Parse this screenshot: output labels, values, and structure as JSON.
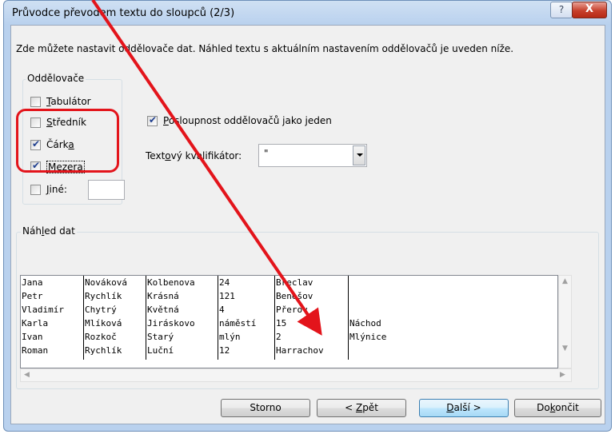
{
  "window": {
    "title": "Průvodce převodem textu do sloupců (2/3)",
    "help_glyph": "?",
    "close_glyph": "X"
  },
  "description": "Zde můžete nastavit oddělovače dat. Náhled textu s aktuálním nastavením oddělovačů je uveden níže.",
  "delimiters": {
    "group_label": "Oddělovače",
    "items": [
      {
        "label_u": "T",
        "label_rest": "abulátor",
        "checked": false
      },
      {
        "label_u": "S",
        "label_rest": "tředník",
        "checked": false
      },
      {
        "label_pre": "Čárk",
        "label_u": "a",
        "checked": true
      },
      {
        "label_u": "M",
        "label_rest": "ezera",
        "checked": true
      },
      {
        "label_u": "J",
        "label_rest": "iné:",
        "checked": false
      }
    ],
    "other_value": ""
  },
  "consecutive": {
    "label_u": "P",
    "label_rest": "osloupnost oddělovačů jako jeden",
    "checked": true
  },
  "qualifier": {
    "label_pre": "Text",
    "label_u": "o",
    "label_rest": "vý kvalifikátor:",
    "value": "\""
  },
  "preview": {
    "label_pre": "Náh",
    "label_u": "l",
    "label_rest": "ed dat",
    "rows": [
      [
        "Jana",
        "Nováková",
        "Kolbenova",
        "24",
        "Břeclav",
        ""
      ],
      [
        "Petr",
        "Rychlík",
        "Krásná",
        "121",
        "Benešov",
        ""
      ],
      [
        "Vladimír",
        "Chytrý",
        "Květná",
        "4",
        "Přerov",
        ""
      ],
      [
        "Karla",
        "Mlíková",
        "Jiráskovo",
        "náměstí",
        "15",
        "Náchod"
      ],
      [
        "Ivan",
        "Rozkoč",
        "Starý",
        "mlýn",
        "2",
        "Mlýnice"
      ],
      [
        "Roman",
        "Rychlík",
        "Luční",
        "12",
        "Harrachov",
        ""
      ]
    ]
  },
  "buttons": {
    "cancel": "Storno",
    "back_pre": "< ",
    "back_u": "Z",
    "back_rest": "pět",
    "next_u": "D",
    "next_rest": "alší >",
    "finish_pre": "Do",
    "finish_u": "k",
    "finish_rest": "ončit"
  },
  "colors": {
    "annotation": "#e3141b"
  }
}
